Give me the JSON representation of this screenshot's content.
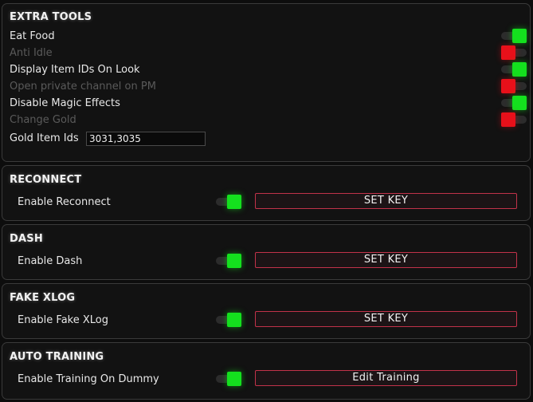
{
  "extra_tools": {
    "title": "EXTRA TOOLS",
    "items": [
      {
        "label": "Eat Food",
        "enabled": true,
        "state": "on"
      },
      {
        "label": "Anti Idle",
        "enabled": false,
        "state": "off"
      },
      {
        "label": "Display Item IDs On Look",
        "enabled": true,
        "state": "on"
      },
      {
        "label": "Open private channel on PM",
        "enabled": false,
        "state": "off"
      },
      {
        "label": "Disable Magic Effects",
        "enabled": true,
        "state": "on"
      },
      {
        "label": "Change Gold",
        "enabled": false,
        "state": "off"
      }
    ],
    "gold_item_ids_label": "Gold Item Ids",
    "gold_item_ids_value": "3031,3035"
  },
  "reconnect": {
    "title": "RECONNECT",
    "label": "Enable Reconnect",
    "state": "on",
    "button_label": "SET KEY"
  },
  "dash": {
    "title": "DASH",
    "label": "Enable Dash",
    "state": "on",
    "button_label": "SET KEY"
  },
  "fake_xlog": {
    "title": "FAKE XLOG",
    "label": "Enable Fake XLog",
    "state": "on",
    "button_label": "SET KEY"
  },
  "auto_training": {
    "title": "AUTO TRAINING",
    "label": "Enable Training On Dummy",
    "state": "on",
    "button_label": "Edit Training"
  },
  "colors": {
    "toggle_on": "#14e01e",
    "toggle_off": "#e8101a",
    "button_border": "#c2324a",
    "background": "#0d0d0d"
  }
}
